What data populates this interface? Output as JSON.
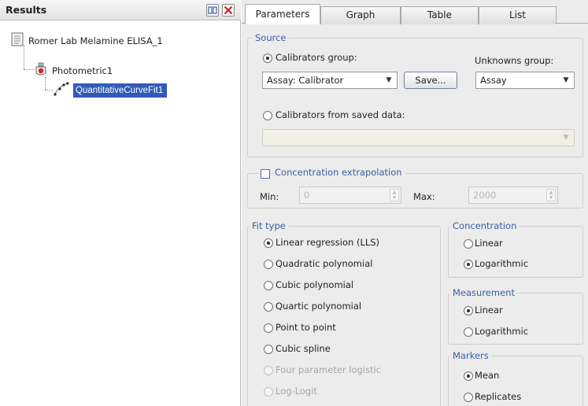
{
  "results": {
    "title": "Results",
    "tree": [
      {
        "label": "Romer Lab Melamine ELISA_1",
        "icon": "document-icon"
      },
      {
        "label": "Photometric1",
        "icon": "photometric-icon"
      },
      {
        "label": "QuantitativeCurveFit1",
        "icon": "curve-fit-icon",
        "selected": true
      }
    ]
  },
  "tabs": [
    "Parameters",
    "Graph",
    "Table",
    "List"
  ],
  "active_tab": "Parameters",
  "source": {
    "title": "Source",
    "calibrators_group_label": "Calibrators group:",
    "calibrators_group_selected": true,
    "calibrators_group_value": "Assay: Calibrator",
    "save_label": "Save...",
    "unknowns_group_label": "Unknowns group:",
    "unknowns_group_value": "Assay",
    "saved_data_label": "Calibrators from saved data:",
    "saved_data_selected": false,
    "saved_data_value": ""
  },
  "extrapolation": {
    "label": "Concentration extrapolation",
    "checked": false,
    "min_label": "Min:",
    "min_value": "0",
    "max_label": "Max:",
    "max_value": "2000"
  },
  "fit_type": {
    "title": "Fit type",
    "options": [
      {
        "label": "Linear regression (LLS)",
        "selected": true,
        "enabled": true
      },
      {
        "label": "Quadratic polynomial",
        "selected": false,
        "enabled": true
      },
      {
        "label": "Cubic polynomial",
        "selected": false,
        "enabled": true
      },
      {
        "label": "Quartic polynomial",
        "selected": false,
        "enabled": true
      },
      {
        "label": "Point to point",
        "selected": false,
        "enabled": true
      },
      {
        "label": "Cubic spline",
        "selected": false,
        "enabled": true
      },
      {
        "label": "Four parameter logistic",
        "selected": false,
        "enabled": false
      },
      {
        "label": "Log-Logit",
        "selected": false,
        "enabled": false
      }
    ]
  },
  "concentration": {
    "title": "Concentration",
    "options": [
      {
        "label": "Linear",
        "selected": false
      },
      {
        "label": "Logarithmic",
        "selected": true
      }
    ]
  },
  "measurement": {
    "title": "Measurement",
    "options": [
      {
        "label": "Linear",
        "selected": true
      },
      {
        "label": "Logarithmic",
        "selected": false
      }
    ]
  },
  "markers": {
    "title": "Markers",
    "options": [
      {
        "label": "Mean",
        "selected": true
      },
      {
        "label": "Replicates",
        "selected": false
      }
    ]
  },
  "colors": {
    "selection": "#2f5bb7",
    "group_title": "#3a5ea8",
    "panel_bg": "#ececec",
    "close_red": "#d42020"
  }
}
